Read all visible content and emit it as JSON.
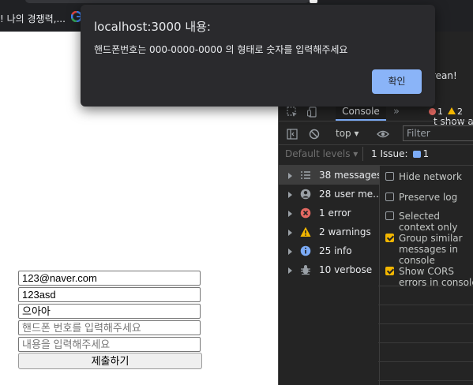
{
  "browser": {
    "bookmark_text": "! 나의 경쟁력,..."
  },
  "form": {
    "email_value": "123@naver.com",
    "password_value": "123asd",
    "name_value": "으아아",
    "phone_placeholder": "핸드폰 번호를  입력해주세요",
    "content_placeholder": "내용을 입력해주세요",
    "submit_label": "제출하기"
  },
  "devtools": {
    "welcome_snippet": "rean!",
    "whatsnew_snippet": "t show a",
    "console_tab": "Console",
    "more_tabs": "»",
    "error_count": "1",
    "warning_count": "2",
    "context_select": "top ▾",
    "filter_placeholder": "Filter",
    "default_levels": "Default levels ▾",
    "issues_label": "1 Issue:",
    "issues_count": "1",
    "sidebar": [
      {
        "label": "38 messages",
        "icon": "list-icon"
      },
      {
        "label": "28 user me...",
        "icon": "user-icon"
      },
      {
        "label": "1 error",
        "icon": "error-icon"
      },
      {
        "label": "2 warnings",
        "icon": "warning-icon"
      },
      {
        "label": "25 info",
        "icon": "info-icon"
      },
      {
        "label": "10 verbose",
        "icon": "bug-icon"
      }
    ],
    "settings": [
      {
        "label": "Hide network",
        "checked": false
      },
      {
        "label": "Preserve log",
        "checked": false
      },
      {
        "label": "Selected context only",
        "checked": false
      },
      {
        "label": "Group similar messages in console",
        "checked": true
      },
      {
        "label": "Show CORS errors in console",
        "checked": true
      }
    ],
    "colors": {
      "error": "#e46962",
      "warning": "#f2b600",
      "info": "#7cacf8"
    }
  },
  "dialog": {
    "title": "localhost:3000 내용:",
    "message": "핸드폰번호는 000-0000-0000 의 형태로 숫자를 입력해주세요",
    "ok_label": "확인",
    "ok_color": "#8ab4f8"
  }
}
